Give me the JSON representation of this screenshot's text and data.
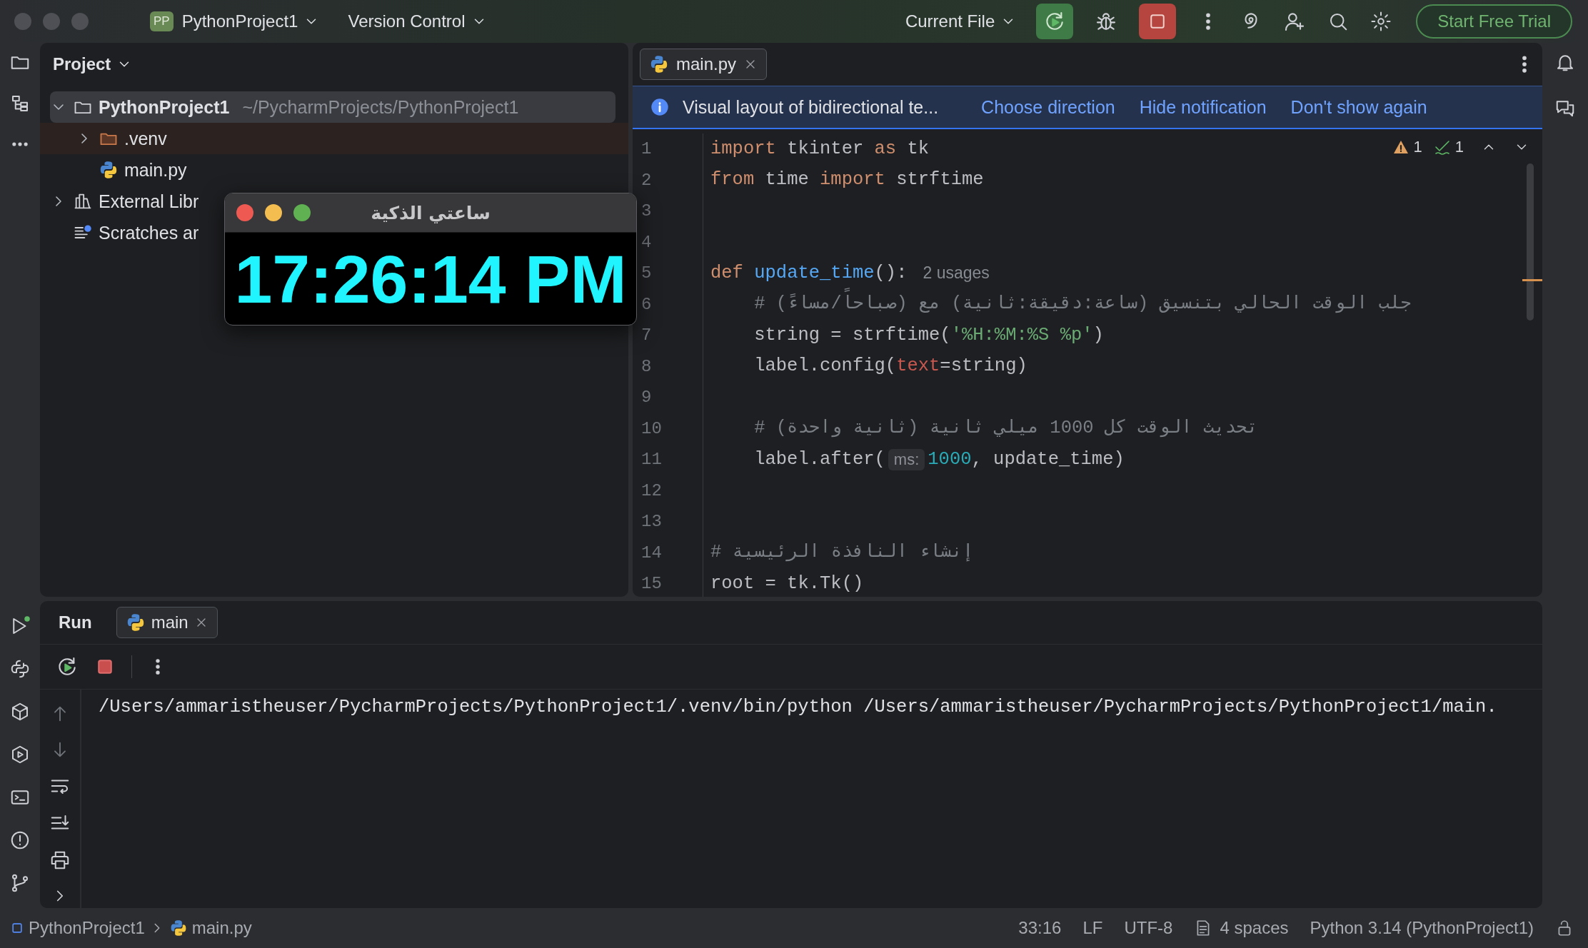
{
  "title_bar": {
    "project_badge": "PP",
    "project": "PythonProject1",
    "vcs": "Version Control",
    "run_config": "Current File",
    "trial_button": "Start Free Trial"
  },
  "project_panel": {
    "title": "Project",
    "tree": [
      {
        "label": "PythonProject1",
        "path": "~/PycharmProjects/PythonProject1",
        "kind": "folder",
        "expanded": true,
        "selected": true,
        "children": [
          {
            "label": ".venv",
            "kind": "excluded-folder",
            "expanded": false,
            "selected": false
          },
          {
            "label": "main.py",
            "kind": "python",
            "selected": false
          }
        ]
      },
      {
        "label": "External Libr",
        "kind": "library",
        "expanded": false,
        "selected": false
      },
      {
        "label": "Scratches ar",
        "kind": "scratches",
        "selected": false
      }
    ]
  },
  "editor": {
    "tabs": [
      {
        "label": "main.py",
        "selected": true
      }
    ],
    "notification": {
      "message": "Visual layout of bidirectional te...",
      "actions": [
        "Choose direction",
        "Hide notification",
        "Don't show again"
      ]
    },
    "inspections": {
      "warnings": "1",
      "weak_warnings": "1"
    },
    "lines": [
      {
        "number": "1",
        "tokens": [
          {
            "kind": "keyword",
            "text": "import"
          },
          {
            "kind": "plain",
            "text": " tkinter "
          },
          {
            "kind": "keyword",
            "text": "as"
          },
          {
            "kind": "plain",
            "text": " tk"
          }
        ]
      },
      {
        "number": "2",
        "tokens": [
          {
            "kind": "keyword",
            "text": "from"
          },
          {
            "kind": "plain",
            "text": " time "
          },
          {
            "kind": "keyword",
            "text": "import"
          },
          {
            "kind": "plain",
            "text": " strftime"
          }
        ]
      },
      {
        "number": "3"
      },
      {
        "number": "4"
      },
      {
        "number": "5",
        "tokens": [
          {
            "kind": "keyword",
            "text": "def "
          },
          {
            "kind": "function",
            "text": "update_time"
          },
          {
            "kind": "plain",
            "text": "():"
          },
          {
            "kind": "hint",
            "text": "2 usages"
          }
        ]
      },
      {
        "number": "6",
        "indented": true,
        "tokens": [
          {
            "kind": "comment",
            "text": "# جلب الوقت الحالي بتنسيق (ساعة:دقيقة:ثانية) مع (صباحاً/مساءً)"
          }
        ]
      },
      {
        "number": "7",
        "indented": true,
        "tokens": [
          {
            "kind": "plain",
            "text": "string = strftime("
          },
          {
            "kind": "string",
            "text": "'%H:%M:%S %p'"
          },
          {
            "kind": "plain",
            "text": ")"
          }
        ]
      },
      {
        "number": "8",
        "indented": true,
        "tokens": [
          {
            "kind": "plain",
            "text": "label.config("
          },
          {
            "kind": "param",
            "text": "text"
          },
          {
            "kind": "plain",
            "text": "=string)"
          }
        ]
      },
      {
        "number": "9"
      },
      {
        "number": "10",
        "indented": true,
        "tokens": [
          {
            "kind": "comment",
            "text": "# تحديث الوقت كل 1000 ميلي ثانية (ثانية واحدة)"
          }
        ]
      },
      {
        "number": "11",
        "indented": true,
        "tokens": [
          {
            "kind": "plain",
            "text": "label.after("
          },
          {
            "kind": "inlay",
            "text": "ms:"
          },
          {
            "kind": "number",
            "text": "1000"
          },
          {
            "kind": "plain",
            "text": ", update_time)"
          }
        ]
      },
      {
        "number": "12"
      },
      {
        "number": "13"
      },
      {
        "number": "14",
        "tokens": [
          {
            "kind": "comment",
            "text": "# إنشاء النافذة الرئيسية"
          }
        ]
      },
      {
        "number": "15",
        "tokens": [
          {
            "kind": "plain",
            "text": "root = tk.Tk()"
          }
        ]
      }
    ]
  },
  "run_panel": {
    "title": "Run",
    "tabs": [
      {
        "label": "main",
        "selected": true
      }
    ],
    "output": [
      "/Users/ammaristheuser/PycharmProjects/PythonProject1/.venv/bin/python /Users/ammaristheuser/PycharmProjects/PythonProject1/main."
    ]
  },
  "status_bar": {
    "breadcrumbs": [
      {
        "label": "PythonProject1",
        "kind": "project"
      },
      {
        "label": "main.py",
        "kind": "python"
      }
    ],
    "items": [
      {
        "label": "33:16",
        "kind": "text"
      },
      {
        "label": "LF",
        "kind": "text"
      },
      {
        "label": "UTF-8",
        "kind": "text"
      },
      {
        "label": "4 spaces",
        "kind": "indent"
      },
      {
        "label": "Python 3.14 (PythonProject1)",
        "kind": "text"
      }
    ]
  },
  "clock_window": {
    "title": "ساعتي الذكية",
    "time": "17:26:14 PM"
  }
}
